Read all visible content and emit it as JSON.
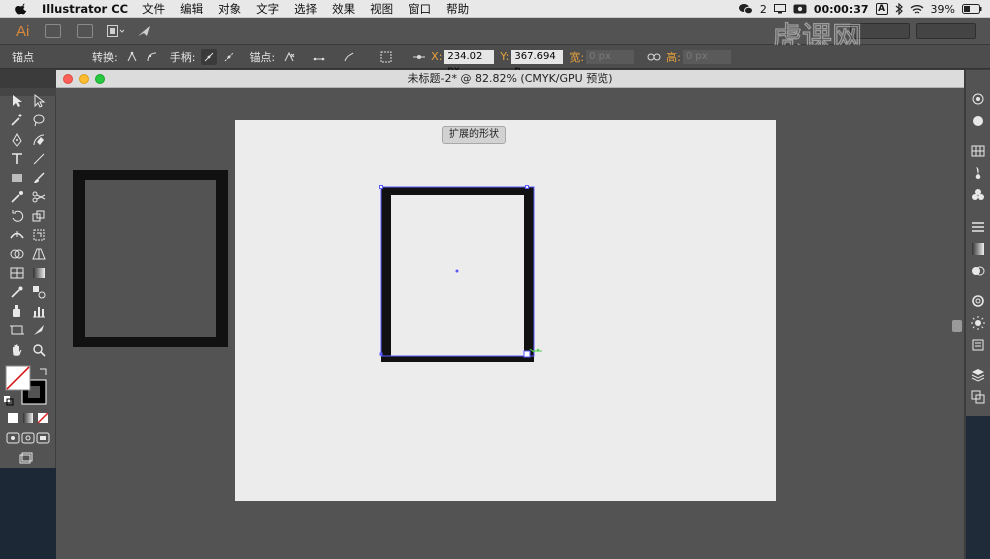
{
  "menubar": {
    "app_name": "Illustrator CC",
    "menus": [
      "文件",
      "编辑",
      "对象",
      "文字",
      "选择",
      "效果",
      "视图",
      "窗口",
      "帮助"
    ],
    "wechat_count": "2",
    "record_time": "00:00:37",
    "input_label": "A",
    "battery": "39%"
  },
  "appbar": {
    "logo": "Ai",
    "brand_watermark": "虎课网"
  },
  "ctrlbar": {
    "anchor_label": "锚点",
    "convert_label": "转换:",
    "handle_label": "手柄:",
    "anchor2_label": "锚点:",
    "x_label": "X:",
    "x_value": "234.02 px",
    "y_label": "Y:",
    "y_value": "367.694 p",
    "w_label": "宽:",
    "w_value": "0 px",
    "h_label": "高:",
    "h_value": "0 px"
  },
  "document": {
    "title": "未标题-2* @ 82.82% (CMYK/GPU 预览)",
    "expand_button": "扩展的形状"
  },
  "colors": {
    "menubar_bg": "#e8e8e8",
    "ui_panel": "#535353",
    "artboard": "#ececec",
    "ai_orange": "#d9893a",
    "frame_black": "#111111",
    "selection_blue": "#5a5aff"
  }
}
